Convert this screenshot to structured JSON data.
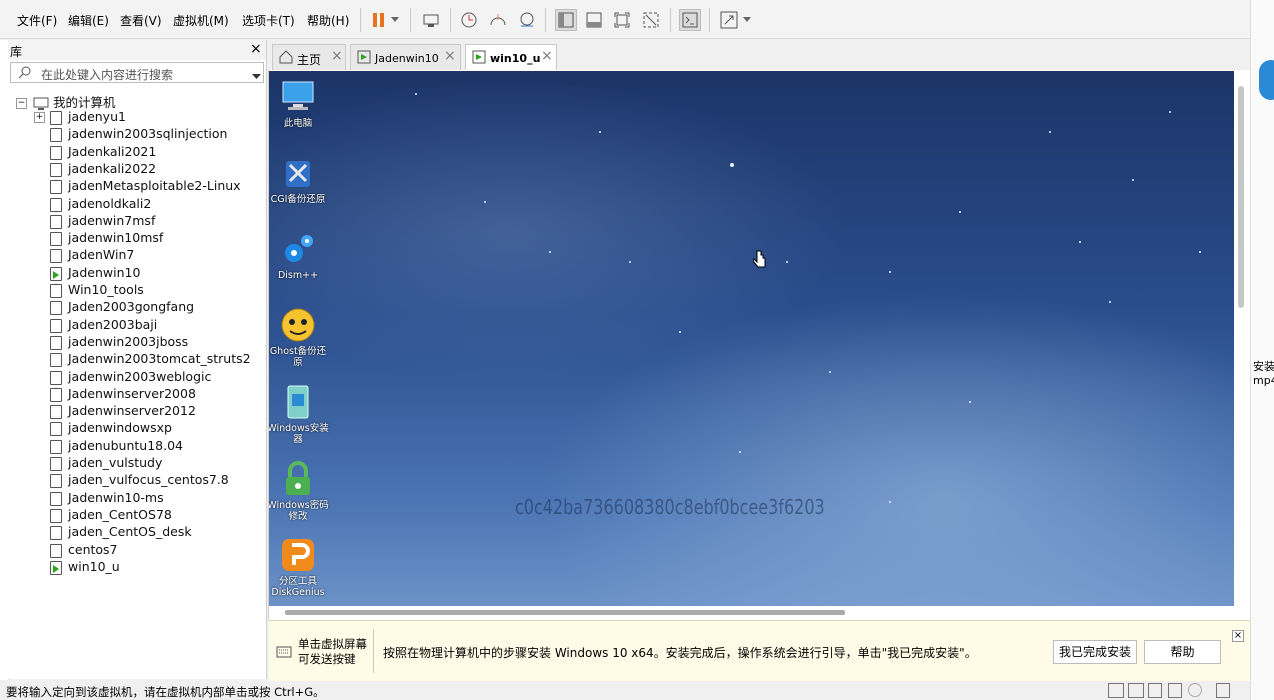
{
  "menu": [
    "文件(F)",
    "编辑(E)",
    "查看(V)",
    "虚拟机(M)",
    "选项卡(T)",
    "帮助(H)"
  ],
  "library": {
    "title": "库",
    "search_placeholder": "在此处键入内容进行搜索",
    "root": "我的计算机",
    "items": [
      {
        "name": "jadenyu1",
        "type": "folder"
      },
      {
        "name": "jadenwin2003sqlinjection"
      },
      {
        "name": "Jadenkali2021"
      },
      {
        "name": "jadenkali2022"
      },
      {
        "name": "jadenMetasploitable2-Linux"
      },
      {
        "name": "jadenoldkali2"
      },
      {
        "name": "jadenwin7msf"
      },
      {
        "name": "jadenwin10msf"
      },
      {
        "name": "JadenWin7"
      },
      {
        "name": "Jadenwin10",
        "running": true
      },
      {
        "name": "Win10_tools"
      },
      {
        "name": "Jaden2003gongfang"
      },
      {
        "name": "Jaden2003baji"
      },
      {
        "name": "jadenwin2003jboss"
      },
      {
        "name": "Jadenwin2003tomcat_struts2"
      },
      {
        "name": "jadenwin2003weblogic"
      },
      {
        "name": "Jadenwinserver2008"
      },
      {
        "name": "Jadenwinserver2012"
      },
      {
        "name": "jadenwindowsxp"
      },
      {
        "name": "jadenubuntu18.04"
      },
      {
        "name": "jaden_vulstudy"
      },
      {
        "name": "jaden_vulfocus_centos7.8"
      },
      {
        "name": "Jadenwin10-ms"
      },
      {
        "name": "jaden_CentOS78"
      },
      {
        "name": "jaden_CentOS_desk"
      },
      {
        "name": "centos7"
      },
      {
        "name": "win10_u",
        "running": true
      }
    ]
  },
  "tabs": [
    {
      "label": "主页"
    },
    {
      "label": "Jadenwin10"
    },
    {
      "label": "win10_u",
      "active": true
    }
  ],
  "desktop": {
    "icons": [
      {
        "label": "此电脑",
        "icon": "computer-icon"
      },
      {
        "label": "CGI备份还原",
        "icon": "tools-icon"
      },
      {
        "label": "Dism++",
        "icon": "gears-icon"
      },
      {
        "label": "Ghost备份还原",
        "icon": "ghost-icon"
      },
      {
        "label": "Windows安装器",
        "icon": "windows-installer-icon"
      },
      {
        "label": "Windows密码修改",
        "icon": "lock-icon"
      },
      {
        "label": "分区工具DiskGenius",
        "icon": "diskgenius-icon"
      }
    ],
    "watermark": "c0c42ba736608380c8ebf0bcee3f6203"
  },
  "hint": {
    "click_hint": "单击虚拟屏幕可发送按键",
    "message": "按照在物理计算机中的步骤安装 Windows 10 x64。安装完成后，操作系统会进行引导，单击\"我已完成安装\"。",
    "done_button": "我已完成安装",
    "help_button": "帮助"
  },
  "status_text": "要将输入定向到该虚拟机，请在虚拟机内部单击或按 Ctrl+G。",
  "right_edge": {
    "line1": "安装",
    "line2": "mp4"
  },
  "colors": {
    "pause": "#e8731d",
    "running": "#2aa31f"
  }
}
